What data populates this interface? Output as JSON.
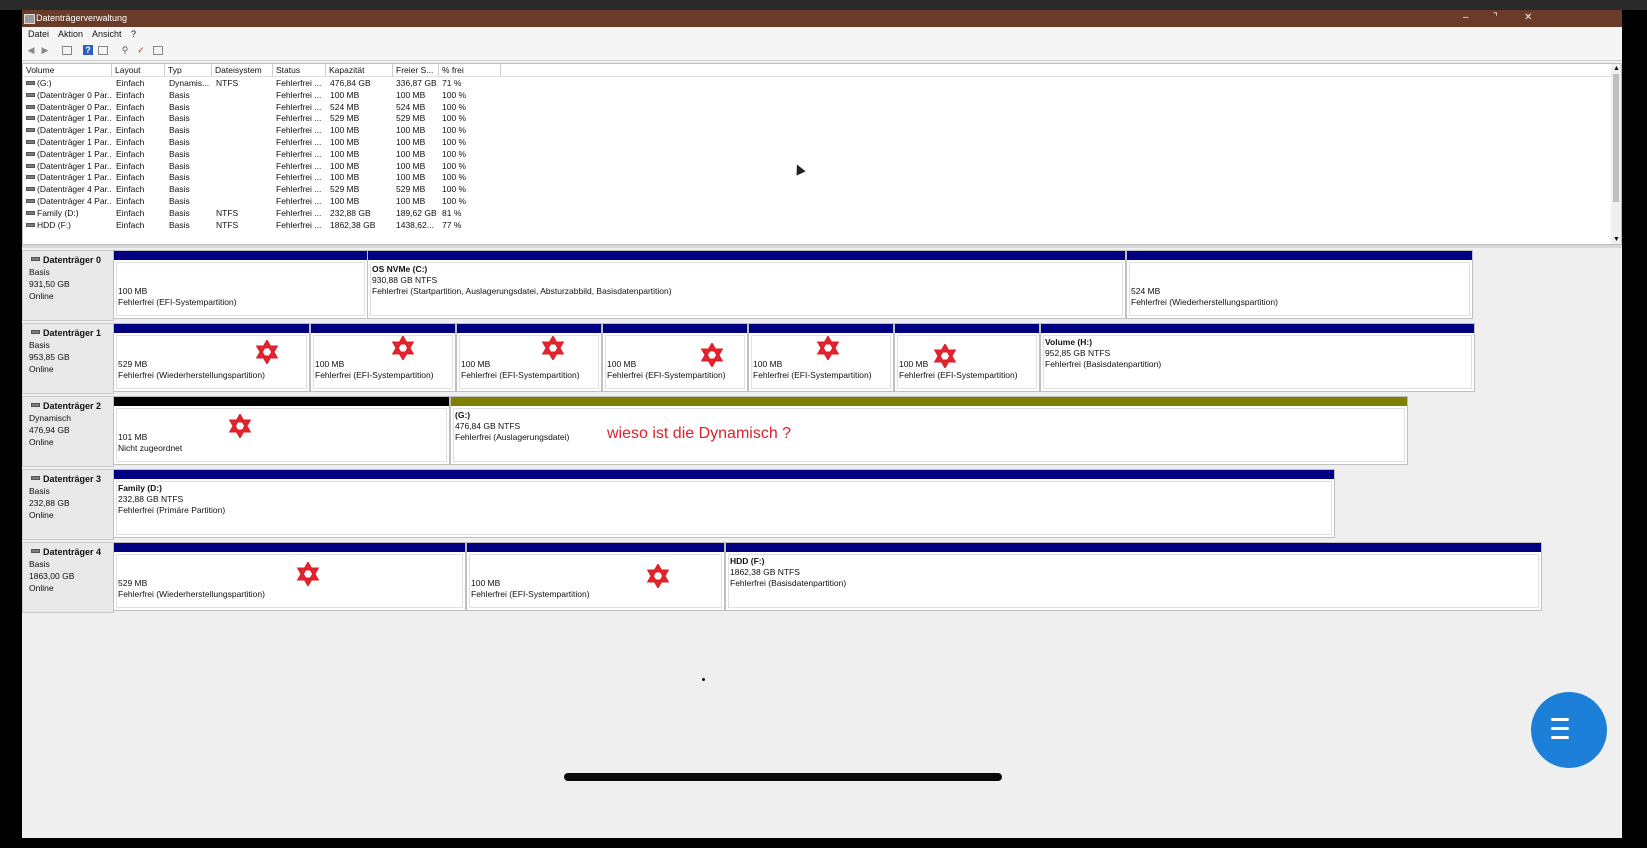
{
  "window": {
    "title": "Datenträgerverwaltung",
    "minimize": "–",
    "maximize": "⌝",
    "close": "✕"
  },
  "menu": [
    "Datei",
    "Aktion",
    "Ansicht",
    "?"
  ],
  "table": {
    "headers": [
      "Volume",
      "Layout",
      "Typ",
      "Dateisystem",
      "Status",
      "Kapazität",
      "Freier S...",
      "% frei"
    ],
    "rows": [
      [
        "(G:)",
        "Einfach",
        "Dynamis...",
        "NTFS",
        "Fehlerfrei ...",
        "476,84 GB",
        "336,87 GB",
        "71 %"
      ],
      [
        "(Datenträger 0 Par...",
        "Einfach",
        "Basis",
        "",
        "Fehlerfrei ...",
        "100 MB",
        "100 MB",
        "100 %"
      ],
      [
        "(Datenträger 0 Par...",
        "Einfach",
        "Basis",
        "",
        "Fehlerfrei ...",
        "524 MB",
        "524 MB",
        "100 %"
      ],
      [
        "(Datenträger 1 Par...",
        "Einfach",
        "Basis",
        "",
        "Fehlerfrei ...",
        "529 MB",
        "529 MB",
        "100 %"
      ],
      [
        "(Datenträger 1 Par...",
        "Einfach",
        "Basis",
        "",
        "Fehlerfrei ...",
        "100 MB",
        "100 MB",
        "100 %"
      ],
      [
        "(Datenträger 1 Par...",
        "Einfach",
        "Basis",
        "",
        "Fehlerfrei ...",
        "100 MB",
        "100 MB",
        "100 %"
      ],
      [
        "(Datenträger 1 Par...",
        "Einfach",
        "Basis",
        "",
        "Fehlerfrei ...",
        "100 MB",
        "100 MB",
        "100 %"
      ],
      [
        "(Datenträger 1 Par...",
        "Einfach",
        "Basis",
        "",
        "Fehlerfrei ...",
        "100 MB",
        "100 MB",
        "100 %"
      ],
      [
        "(Datenträger 1 Par...",
        "Einfach",
        "Basis",
        "",
        "Fehlerfrei ...",
        "100 MB",
        "100 MB",
        "100 %"
      ],
      [
        "(Datenträger 4 Par...",
        "Einfach",
        "Basis",
        "",
        "Fehlerfrei ...",
        "529 MB",
        "529 MB",
        "100 %"
      ],
      [
        "(Datenträger 4 Par...",
        "Einfach",
        "Basis",
        "",
        "Fehlerfrei ...",
        "100 MB",
        "100 MB",
        "100 %"
      ],
      [
        "Family (D:)",
        "Einfach",
        "Basis",
        "NTFS",
        "Fehlerfrei ...",
        "232,88 GB",
        "189,62 GB",
        "81 %"
      ],
      [
        "HDD (F:)",
        "Einfach",
        "Basis",
        "NTFS",
        "Fehlerfrei ...",
        "1862,38 GB",
        "1438,62...",
        "77 %"
      ]
    ]
  },
  "disks": [
    {
      "name": "Datenträger 0",
      "type": "Basis",
      "size": "931,50 GB",
      "state": "Online",
      "parts": [
        {
          "title": "",
          "size": "100 MB",
          "status": "Fehlerfrei (EFI-Systempartition)",
          "bar": "#010080"
        },
        {
          "title": "OS NVMe  (C:)",
          "size": "930,88 GB NTFS",
          "status": "Fehlerfrei (Startpartition, Auslagerungsdatei, Absturzabbild, Basisdatenpartition)",
          "bar": "#010080"
        },
        {
          "title": "",
          "size": "524 MB",
          "status": "Fehlerfrei (Wiederherstellungspartition)",
          "bar": "#010080"
        }
      ]
    },
    {
      "name": "Datenträger 1",
      "type": "Basis",
      "size": "953,85 GB",
      "state": "Online",
      "parts": [
        {
          "title": "",
          "size": "529 MB",
          "status": "Fehlerfrei (Wiederherstellungspartition)",
          "bar": "#010080"
        },
        {
          "title": "",
          "size": "100 MB",
          "status": "Fehlerfrei (EFI-Systempartition)",
          "bar": "#010080"
        },
        {
          "title": "",
          "size": "100 MB",
          "status": "Fehlerfrei (EFI-Systempartition)",
          "bar": "#010080"
        },
        {
          "title": "",
          "size": "100 MB",
          "status": "Fehlerfrei (EFI-Systempartition)",
          "bar": "#010080"
        },
        {
          "title": "",
          "size": "100 MB",
          "status": "Fehlerfrei (EFI-Systempartition)",
          "bar": "#010080"
        },
        {
          "title": "",
          "size": "100 MB",
          "status": "Fehlerfrei (EFI-Systempartition)",
          "bar": "#010080"
        },
        {
          "title": "Volume  (H:)",
          "size": "952,85 GB NTFS",
          "status": "Fehlerfrei (Basisdatenpartition)",
          "bar": "#010080"
        }
      ]
    },
    {
      "name": "Datenträger 2",
      "type": "Dynamisch",
      "size": "476,94 GB",
      "state": "Online",
      "parts": [
        {
          "title": "",
          "size": "101 MB",
          "status": "Nicht zugeordnet",
          "bar": "#000000"
        },
        {
          "title": "(G:)",
          "size": "476,84 GB NTFS",
          "status": "Fehlerfrei (Auslagerungsdatei)",
          "bar": "#808000"
        }
      ]
    },
    {
      "name": "Datenträger 3",
      "type": "Basis",
      "size": "232,88 GB",
      "state": "Online",
      "parts": [
        {
          "title": "Family  (D:)",
          "size": "232,88 GB NTFS",
          "status": "Fehlerfrei (Primäre Partition)",
          "bar": "#010080"
        }
      ]
    },
    {
      "name": "Datenträger 4",
      "type": "Basis",
      "size": "1863,00 GB",
      "state": "Online",
      "parts": [
        {
          "title": "",
          "size": "529 MB",
          "status": "Fehlerfrei (Wiederherstellungspartition)",
          "bar": "#010080"
        },
        {
          "title": "",
          "size": "100 MB",
          "status": "Fehlerfrei (EFI-Systempartition)",
          "bar": "#010080"
        },
        {
          "title": "HDD  (F:)",
          "size": "1862,38 GB NTFS",
          "status": "Fehlerfrei (Basisdatenpartition)",
          "bar": "#010080"
        }
      ]
    }
  ],
  "annotation": "wieso ist die Dynamisch ?",
  "colors": {
    "accent": "#010080",
    "dynamic": "#808000",
    "unallocated": "#000000",
    "annotation": "#e0202a"
  }
}
